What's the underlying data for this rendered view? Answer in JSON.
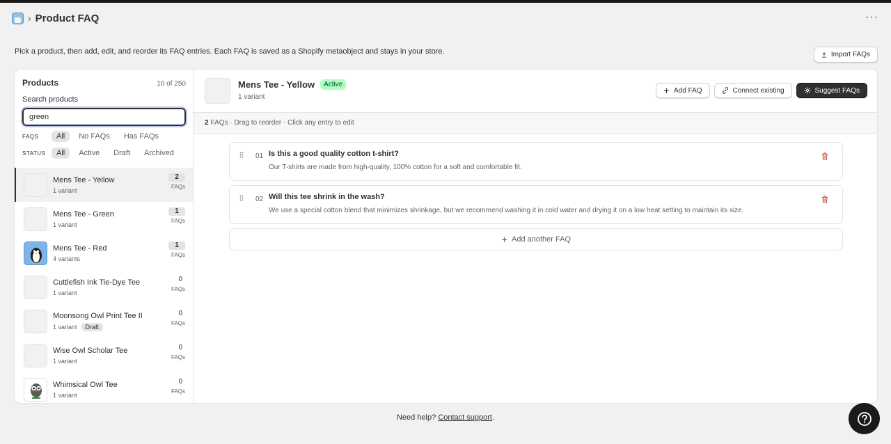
{
  "app": {
    "title": "Product FAQ",
    "crumb_separator": "›",
    "more_label": "···"
  },
  "intro": "Pick a product, then add, edit, and reorder its FAQ entries. Each FAQ is saved as a Shopify metaobject and stays in your store.",
  "import_button": "Import FAQs",
  "sidebar": {
    "title": "Products",
    "count": "10 of 250",
    "search_label": "Search products",
    "search_value": "green",
    "faqs_filter": {
      "label": "FAQS",
      "options": [
        "All",
        "No FAQs",
        "Has FAQs"
      ],
      "selected": "All"
    },
    "status_filter": {
      "label": "STATUS",
      "options": [
        "All",
        "Active",
        "Draft",
        "Archived"
      ],
      "selected": "All"
    },
    "faq_count_label": "FAQs",
    "products": [
      {
        "name": "Mens Tee - Yellow",
        "variants": "1 variant",
        "count": "2",
        "thumb": "placeholder",
        "selected": true
      },
      {
        "name": "Mens Tee - Green",
        "variants": "1 variant",
        "count": "1",
        "thumb": "placeholder"
      },
      {
        "name": "Mens Tee - Red",
        "variants": "4 variants",
        "count": "1",
        "thumb": "penguin-image"
      },
      {
        "name": "Cuttlefish Ink Tie-Dye Tee",
        "variants": "1 variant",
        "count": "0",
        "thumb": "placeholder"
      },
      {
        "name": "Moonsong Owl Print Tee II",
        "variants": "1 variant",
        "count": "0",
        "thumb": "placeholder",
        "badge": "Draft"
      },
      {
        "name": "Wise Owl Scholar Tee",
        "variants": "1 variant",
        "count": "0",
        "thumb": "placeholder"
      },
      {
        "name": "Whimsical Owl Tee",
        "variants": "1 variant",
        "count": "0",
        "thumb": "owl-image"
      }
    ]
  },
  "product": {
    "title": "Mens Tee - Yellow",
    "status": "Active",
    "variants": "1 variant",
    "actions": {
      "add_faq": "Add FAQ",
      "connect_existing": "Connect existing",
      "suggest": "Suggest FAQs"
    },
    "info_count": "2",
    "info_text": "FAQs · Drag to reorder · Click any entry to edit",
    "faqs": [
      {
        "num": "01",
        "question": "Is this a good quality cotton t-shirt?",
        "answer": "Our T-shirts are made from high-quality, 100% cotton for a soft and comfortable fit."
      },
      {
        "num": "02",
        "question": "Will this tee shrink in the wash?",
        "answer": "We use a special cotton blend that minimizes shrinkage, but we recommend washing it in cold water and drying it on a low heat setting to maintain its size."
      }
    ],
    "add_another": "Add another FAQ"
  },
  "footer": {
    "text": "Need help?",
    "link": "Contact support",
    "suffix": "."
  },
  "colors": {
    "active_badge_bg": "#affebf",
    "primary_dark": "#303030",
    "page_bg": "#f1f1f1"
  }
}
